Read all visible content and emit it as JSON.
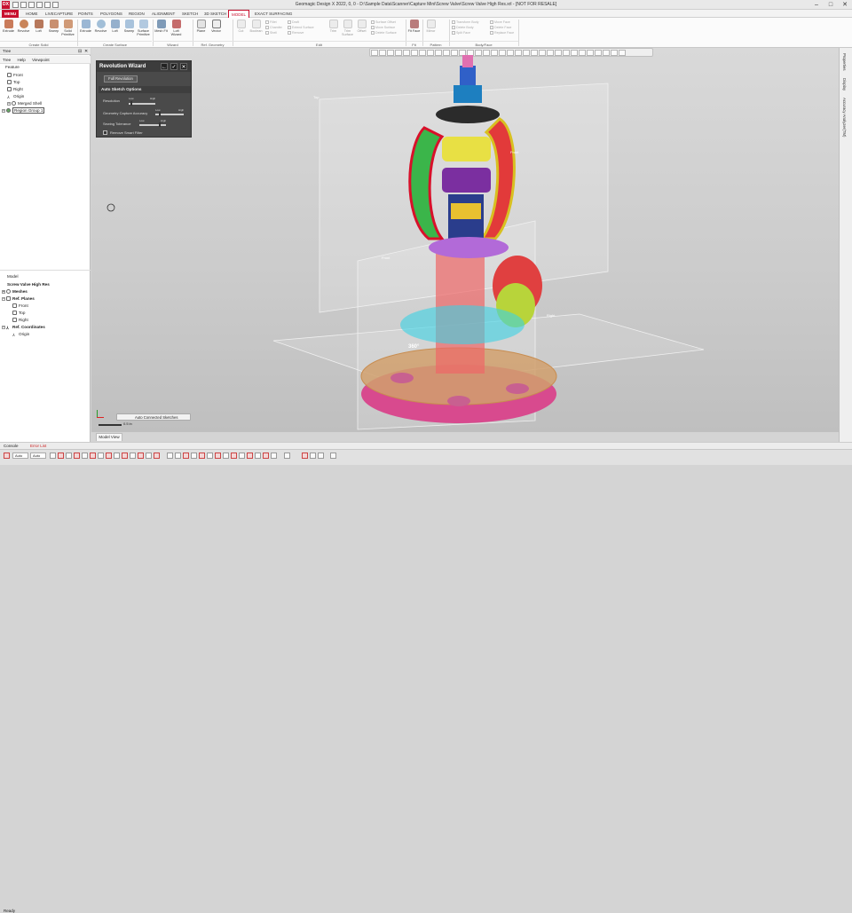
{
  "app": {
    "title": "Geomagic Design X 2022, 0, 0 - D:\\Sample Data\\Scanner\\Capture Mini\\Screw Valve\\Screw Valve High Res.xrl - [NOT FOR RESALE]",
    "logo_text": "DX"
  },
  "menu_tabs": [
    "MENU",
    "HOME",
    "LIVECAPTURE",
    "POINTS",
    "POLYGONS",
    "REGION",
    "ALIGNMENT",
    "SKETCH",
    "3D SKETCH",
    "MODEL",
    "EXACT SURFACING"
  ],
  "active_tab": "MODEL",
  "ribbon": {
    "create_solid": {
      "label": "Create Solid",
      "buttons": [
        "Extrude",
        "Revolve",
        "Loft",
        "Sweep",
        "Solid Primitive"
      ]
    },
    "create_surface": {
      "label": "Create Surface",
      "buttons": [
        "Extrude",
        "Revolve",
        "Loft",
        "Sweep",
        "Surface Primitive"
      ]
    },
    "wizard": {
      "label": "Wizard",
      "buttons": [
        "Mesh Fit",
        "Loft Wizard"
      ]
    },
    "ref_geometry": {
      "label": "Ref. Geometry",
      "buttons": [
        "Plane",
        "Vector"
      ]
    },
    "edit": {
      "label": "Edit",
      "buttons": [
        "Cut",
        "Boolean"
      ],
      "small": [
        "Fillet",
        "Chamfer",
        "Shell",
        "Draft",
        "Extend Surface",
        "Remove",
        "Trim",
        "Trim Surface",
        "Offset",
        "Thicken",
        "Untrim Surface",
        "Sew",
        "Surface Offset",
        "Move Surface",
        "Delete Surface"
      ]
    },
    "fit": {
      "label": "Fit",
      "buttons": [
        "Fit Face"
      ]
    },
    "pattern": {
      "label": "Pattern",
      "buttons": [
        "Mirror"
      ]
    },
    "body_face": {
      "label": "Body/Face",
      "small": [
        "Transform Body",
        "Delete Body",
        "Split Face",
        "Move Face",
        "Delete Face",
        "Replace Face"
      ]
    }
  },
  "left_panel": {
    "header": "Tree",
    "tabs": [
      "Tree",
      "Help",
      "Viewpoint"
    ],
    "feature_label": "Feature",
    "feature_items": [
      "Front",
      "Top",
      "Right",
      "Origin",
      "Merged Shell",
      "Region Group 1"
    ],
    "model_label": "Model",
    "model_root": "Screw Valve High Res",
    "model_items": [
      {
        "label": "Meshes",
        "indent": 1,
        "bold": true
      },
      {
        "label": "Ref. Planes",
        "indent": 1,
        "bold": true
      },
      {
        "label": "Front",
        "indent": 2,
        "bold": false
      },
      {
        "label": "Top",
        "indent": 2,
        "bold": false
      },
      {
        "label": "Right",
        "indent": 2,
        "bold": false
      },
      {
        "label": "Ref. Coordinates",
        "indent": 1,
        "bold": true
      },
      {
        "label": "Origin",
        "indent": 2,
        "bold": false
      }
    ]
  },
  "wizard": {
    "title": "Revolution Wizard",
    "full_revolution": "Full Revolution",
    "section": "Auto Sketch Options",
    "resolution_label": "Resolution",
    "resolution_ticks": [
      "Low",
      "High"
    ],
    "resolution_value": 0.08,
    "accuracy_label": "Geometry Capture Accuracy",
    "accuracy_ticks": [
      "Low",
      "High"
    ],
    "accuracy_value": 0.15,
    "tolerance_label": "Sewing Tolerance",
    "tolerance_ticks": [
      "Low",
      "High"
    ],
    "tolerance_value": 0.82,
    "smart_filter_label": "Remove Smart Filter"
  },
  "viewport": {
    "plane_labels": [
      "Top",
      "Front",
      "Right"
    ],
    "angle_label": "360°",
    "bottom_chip": "Auto Connected Sketches",
    "scale_label": "0.5 in",
    "tab": "Model View"
  },
  "right_panel_tabs": [
    "Properties",
    "Display",
    "Accuracy Analyzer(TM)"
  ],
  "bottom_tabs": [
    "Console",
    "Error List"
  ],
  "status": {
    "ready": "Ready",
    "modes": [
      "Auto",
      "Auto"
    ]
  },
  "colors": {
    "accent": "#c8102e",
    "panel_dark": "#4a4a4a"
  }
}
